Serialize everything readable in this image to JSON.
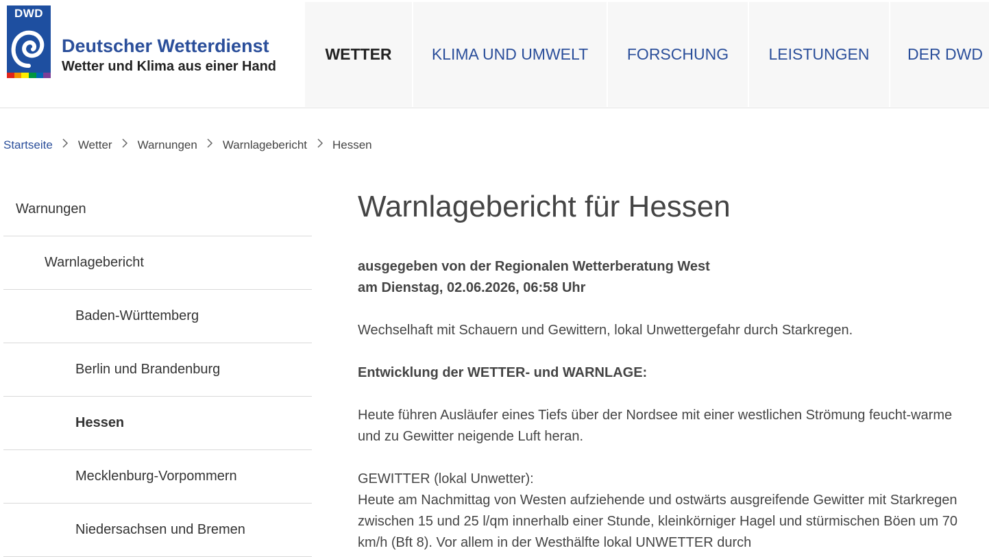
{
  "logo": {
    "badge": "DWD",
    "name": "Deutscher Wetterdienst",
    "tagline": "Wetter und Klima aus einer Hand",
    "rainbow_colors": [
      "#e2231a",
      "#f39200",
      "#ffed00",
      "#009640",
      "#0069b4",
      "#7b3f98"
    ]
  },
  "nav": {
    "items": [
      {
        "label": "WETTER"
      },
      {
        "label": "KLIMA UND UMWELT"
      },
      {
        "label": "FORSCHUNG"
      },
      {
        "label": "LEISTUNGEN"
      },
      {
        "label": "DER DWD"
      }
    ]
  },
  "breadcrumb": {
    "items": [
      "Startseite",
      "Wetter",
      "Warnungen",
      "Warnlagebericht",
      "Hessen"
    ]
  },
  "sidebar": {
    "items": [
      {
        "label": "Warnungen"
      },
      {
        "label": "Warnlagebericht"
      },
      {
        "label": "Baden-Württemberg"
      },
      {
        "label": "Berlin und Brandenburg"
      },
      {
        "label": "Hessen"
      },
      {
        "label": "Mecklenburg-Vorpommern"
      },
      {
        "label": "Niedersachsen und Bremen"
      }
    ]
  },
  "main": {
    "title": "Warnlagebericht für Hessen",
    "issued_by": "ausgegeben von der Regionalen Wetterberatung West",
    "issued_at": "am Dienstag, 02.06.2026, 06:58 Uhr",
    "summary": "Wechselhaft mit Schauern und Gewittern, lokal Unwettergefahr durch Starkregen.",
    "development_heading": "Entwicklung der WETTER- und WARNLAGE:",
    "development_text": "Heute führen Ausläufer eines Tiefs über der Nordsee mit einer westlichen Strömung feucht-warme und zu Gewitter neigende Luft heran.",
    "gewitter_title": "GEWITTER (lokal Unwetter):",
    "gewitter_text": "Heute am Nachmittag von Westen aufziehende und ostwärts ausgreifende Gewitter mit Starkregen zwischen 15 und 25 l/qm innerhalb einer Stunde, kleinkörniger Hagel und stürmischen Böen um 70 km/h (Bft 8). Vor allem in der Westhälfte lokal UNWETTER durch"
  },
  "colors": {
    "brand_blue": "#2a4e9a",
    "logo_blue": "#1e4fa0"
  }
}
